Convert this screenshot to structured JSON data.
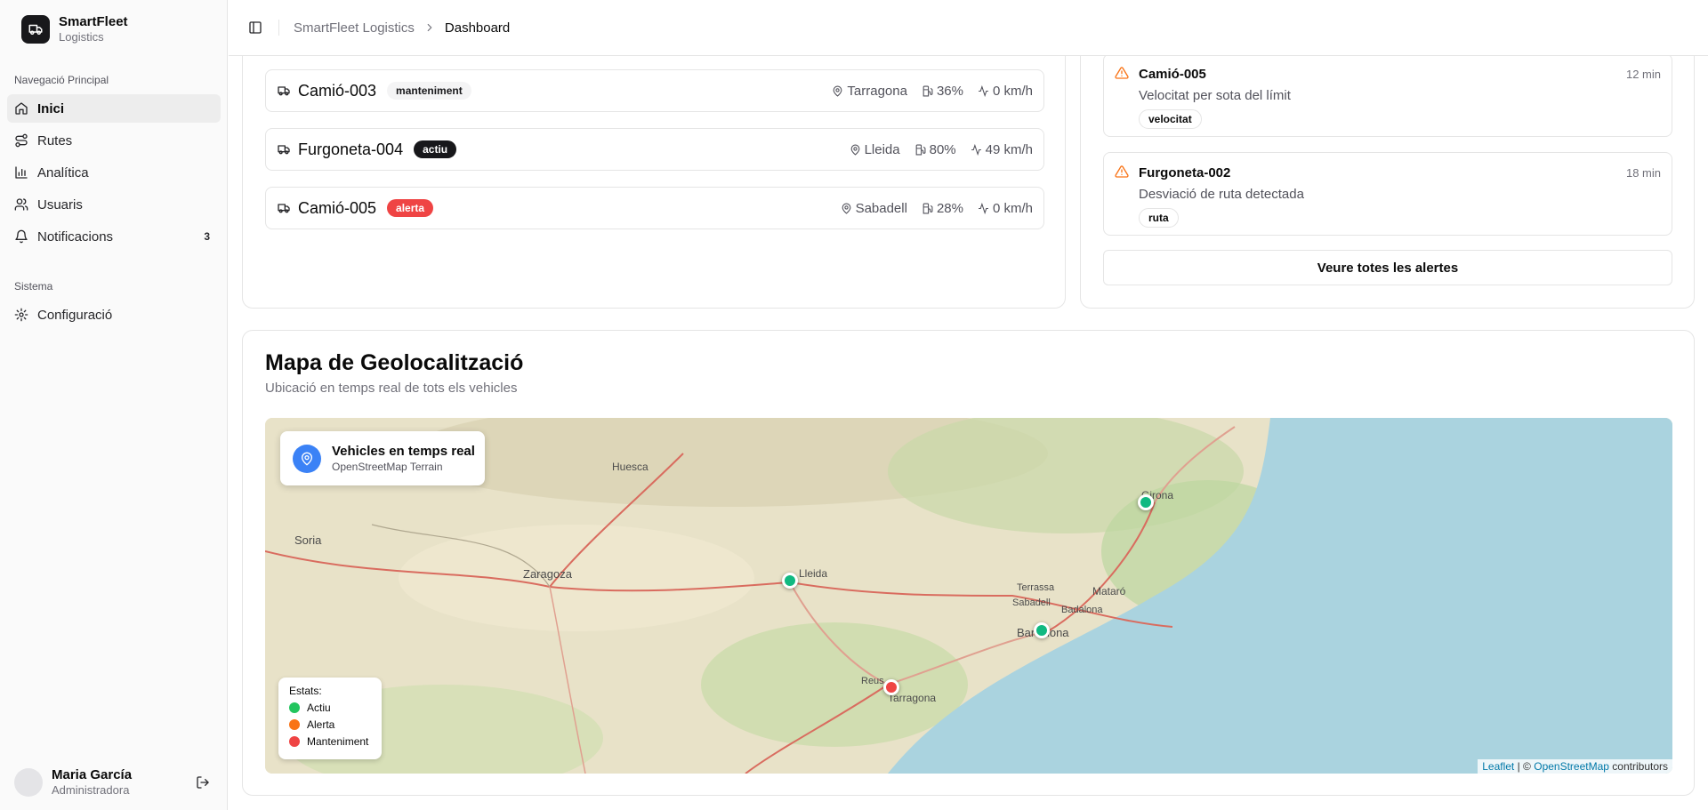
{
  "brand": {
    "name": "SmartFleet",
    "sub": "Logistics"
  },
  "sidebar": {
    "main_label": "Navegació Principal",
    "items": [
      {
        "label": "Inici",
        "icon": "home-icon"
      },
      {
        "label": "Rutes",
        "icon": "route-icon"
      },
      {
        "label": "Analítica",
        "icon": "bar-chart-icon"
      },
      {
        "label": "Usuaris",
        "icon": "users-icon"
      },
      {
        "label": "Notificacions",
        "icon": "bell-icon",
        "count": "3"
      }
    ],
    "system_label": "Sistema",
    "system_items": [
      {
        "label": "Configuració",
        "icon": "gear-icon"
      }
    ]
  },
  "user": {
    "name": "Maria García",
    "role": "Administradora"
  },
  "header": {
    "crumb_root": "SmartFleet Logistics",
    "crumb_current": "Dashboard"
  },
  "vehicles": [
    {
      "name": "Camió-003",
      "status": "manteniment",
      "location": "Tarragona",
      "fuel": "36%",
      "speed": "0 km/h"
    },
    {
      "name": "Furgoneta-004",
      "status": "actiu",
      "location": "Lleida",
      "fuel": "80%",
      "speed": "49 km/h"
    },
    {
      "name": "Camió-005",
      "status": "alerta",
      "location": "Sabadell",
      "fuel": "28%",
      "speed": "0 km/h"
    }
  ],
  "alerts": [
    {
      "title": "Camió-005",
      "time": "12 min",
      "desc": "Velocitat per sota del límit",
      "tag": "velocitat"
    },
    {
      "title": "Furgoneta-002",
      "time": "18 min",
      "desc": "Desviació de ruta detectada",
      "tag": "ruta"
    }
  ],
  "alerts_button": "Veure totes les alertes",
  "map": {
    "title": "Mapa de Geolocalització",
    "subtitle": "Ubicació en temps real de tots els vehicles",
    "panel_title": "Vehicles en temps real",
    "panel_sub": "OpenStreetMap Terrain",
    "legend_title": "Estats:",
    "legend": [
      {
        "label": "Actiu",
        "color": "#22c55e"
      },
      {
        "label": "Alerta",
        "color": "#f97316"
      },
      {
        "label": "Manteniment",
        "color": "#ef4444"
      }
    ],
    "cities": [
      "Huesca",
      "Zaragoza",
      "Soria",
      "Lleida",
      "Tarragona",
      "Reus",
      "Barcelona",
      "Sabadell",
      "Terrassa",
      "Mataró",
      "Girona",
      "Badalona"
    ],
    "attribution": {
      "leaflet": "Leaflet",
      "sep": "| ©",
      "osm": "OpenStreetMap",
      "suffix": "contributors"
    }
  },
  "colors": {
    "accent": "#18181b",
    "alert": "#ef4444",
    "active_marker": "#10b981",
    "sea": "#aad3df",
    "warning": "#f97316"
  }
}
